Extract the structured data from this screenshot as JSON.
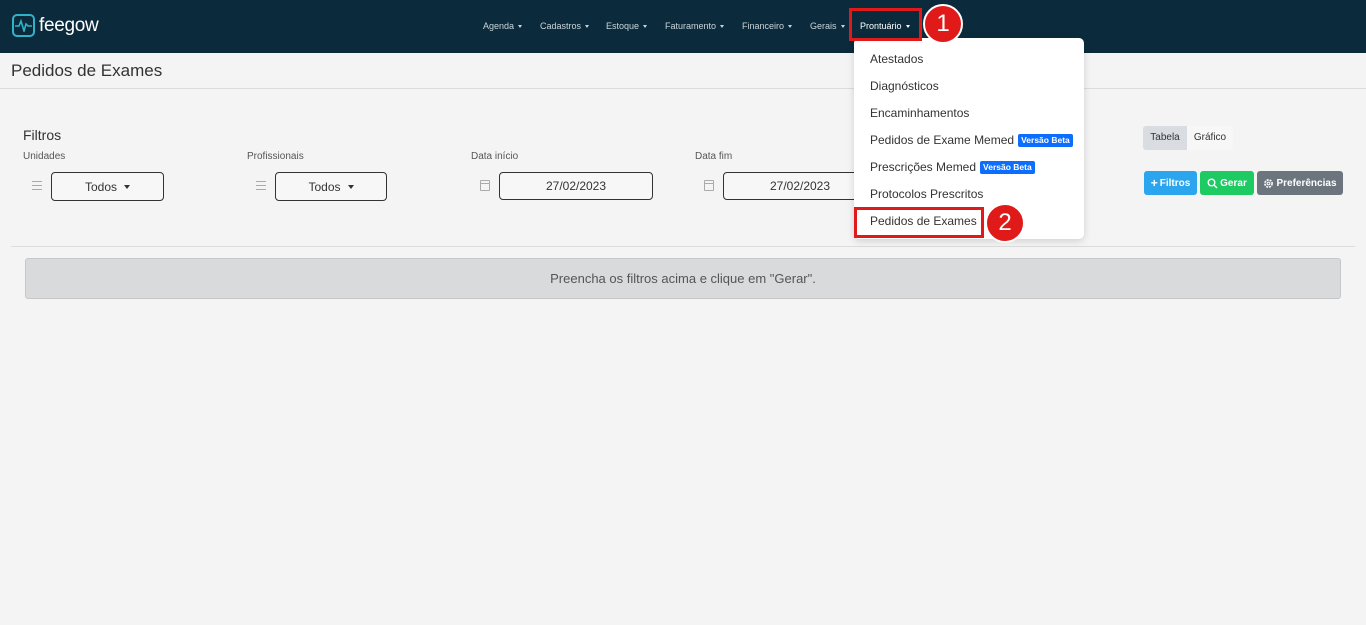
{
  "app": {
    "logo_text": "feegow"
  },
  "nav": {
    "items": [
      {
        "label": "Agenda"
      },
      {
        "label": "Cadastros"
      },
      {
        "label": "Estoque"
      },
      {
        "label": "Faturamento"
      },
      {
        "label": "Financeiro"
      },
      {
        "label": "Gerais"
      },
      {
        "label": "Prontuário"
      }
    ]
  },
  "dropdown": {
    "items": [
      {
        "label": "Atestados"
      },
      {
        "label": "Diagnósticos"
      },
      {
        "label": "Encaminhamentos"
      },
      {
        "label": "Pedidos de Exame Memed",
        "badge": "Versão Beta"
      },
      {
        "label": "Prescrições Memed",
        "badge": "Versão Beta"
      },
      {
        "label": "Protocolos Prescritos"
      },
      {
        "label": "Pedidos de Exames"
      }
    ]
  },
  "annotations": {
    "step1": "1",
    "step2": "2"
  },
  "page": {
    "title": "Pedidos de Exames"
  },
  "filters": {
    "title": "Filtros",
    "unidades": {
      "label": "Unidades",
      "value": "Todos"
    },
    "profissionais": {
      "label": "Profissionais",
      "value": "Todos"
    },
    "data_inicio": {
      "label": "Data início",
      "value": "27/02/2023"
    },
    "data_fim": {
      "label": "Data fim",
      "value": "27/02/2023"
    }
  },
  "view_toggle": {
    "tabela": "Tabela",
    "grafico": "Gráfico"
  },
  "actions": {
    "filtros": "Filtros",
    "gerar": "Gerar",
    "preferencias": "Preferências"
  },
  "info_message": "Preencha os filtros acima e clique em \"Gerar\".",
  "colors": {
    "navbar": "#0b2b3c",
    "annotation": "#e01919",
    "filtros_btn": "#2aa5ee",
    "gerar_btn": "#1ecb63",
    "prefs_btn": "#6c757d",
    "badge": "#0d6efd"
  }
}
